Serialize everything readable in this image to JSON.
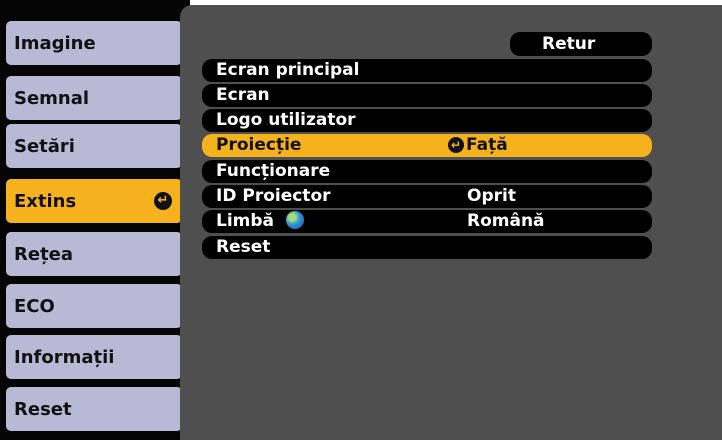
{
  "colors": {
    "accent": "#f5b21d",
    "sidebar_item": "#b9b9d6",
    "panel": "#4f4f4f"
  },
  "sidebar": {
    "items": [
      {
        "label": "Imagine"
      },
      {
        "label": "Semnal"
      },
      {
        "label": "Setări"
      },
      {
        "label": "Extins",
        "active": true,
        "icon": "enter-icon"
      },
      {
        "label": "Rețea"
      },
      {
        "label": "ECO"
      },
      {
        "label": "Informații"
      },
      {
        "label": "Reset"
      }
    ]
  },
  "submenu": {
    "return_label": "Retur",
    "items": [
      {
        "label": "Ecran principal",
        "value": ""
      },
      {
        "label": "Ecran",
        "value": ""
      },
      {
        "label": "Logo utilizator",
        "value": ""
      },
      {
        "label": "Proiecție",
        "value": "Față",
        "selected": true,
        "value_icon": "enter-icon"
      },
      {
        "label": "Funcționare",
        "value": ""
      },
      {
        "label": "ID Proiector",
        "value": "Oprit"
      },
      {
        "label": "Limbă",
        "value": "Română",
        "icon": "globe-icon"
      },
      {
        "label": "Reset",
        "value": ""
      }
    ]
  }
}
